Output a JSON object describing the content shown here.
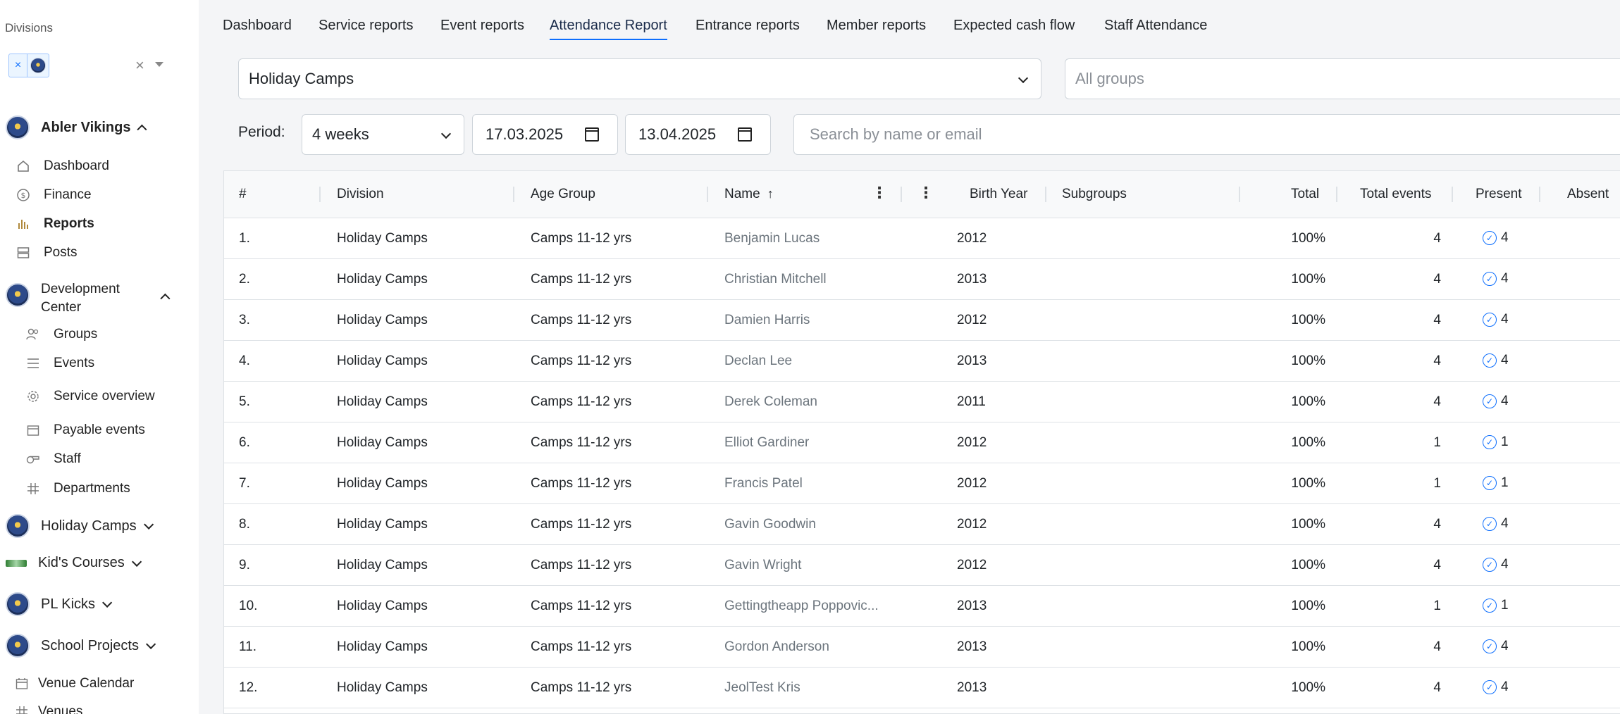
{
  "sidebar": {
    "divisions_label": "Divisions",
    "chip_remove": "×",
    "clear": "×",
    "orgs": {
      "abler": "Abler Vikings",
      "dev_center_line1": "Development",
      "dev_center_line2": "Center",
      "holiday": "Holiday Camps",
      "kids": "Kid's Courses",
      "pl": "PL Kicks",
      "school": "School Projects"
    },
    "items": {
      "dashboard": "Dashboard",
      "finance": "Finance",
      "reports": "Reports",
      "posts": "Posts",
      "groups": "Groups",
      "events": "Events",
      "service_overview": "Service overview",
      "payable_events": "Payable events",
      "staff": "Staff",
      "departments": "Departments",
      "venue_calendar": "Venue Calendar",
      "venues": "Venues"
    }
  },
  "tabs": {
    "dashboard": "Dashboard",
    "service_reports": "Service reports",
    "event_reports": "Event reports",
    "attendance_report": "Attendance Report",
    "entrance_reports": "Entrance reports",
    "member_reports": "Member reports",
    "expected_cash_flow": "Expected cash flow",
    "staff_attendance": "Staff Attendance"
  },
  "filters": {
    "division": "Holiday Camps",
    "groups_placeholder": "All groups",
    "period_label": "Period:",
    "period": "4 weeks",
    "date_from": "17.03.2025",
    "date_to": "13.04.2025",
    "search_placeholder": "Search by name or email"
  },
  "table": {
    "headers": {
      "num": "#",
      "division": "Division",
      "age_group": "Age Group",
      "name": "Name",
      "sort_arrow": "↑",
      "birth_year": "Birth Year",
      "subgroups": "Subgroups",
      "total": "Total",
      "total_events": "Total events",
      "present": "Present",
      "absent": "Absent"
    },
    "rows": [
      {
        "num": "1.",
        "division": "Holiday Camps",
        "age_group": "Camps 11-12 yrs",
        "name": "Benjamin Lucas",
        "birth_year": "2012",
        "total": "100%",
        "total_events": "4",
        "present": "4"
      },
      {
        "num": "2.",
        "division": "Holiday Camps",
        "age_group": "Camps 11-12 yrs",
        "name": "Christian Mitchell",
        "birth_year": "2013",
        "total": "100%",
        "total_events": "4",
        "present": "4"
      },
      {
        "num": "3.",
        "division": "Holiday Camps",
        "age_group": "Camps 11-12 yrs",
        "name": "Damien Harris",
        "birth_year": "2012",
        "total": "100%",
        "total_events": "4",
        "present": "4"
      },
      {
        "num": "4.",
        "division": "Holiday Camps",
        "age_group": "Camps 11-12 yrs",
        "name": "Declan Lee",
        "birth_year": "2013",
        "total": "100%",
        "total_events": "4",
        "present": "4"
      },
      {
        "num": "5.",
        "division": "Holiday Camps",
        "age_group": "Camps 11-12 yrs",
        "name": "Derek Coleman",
        "birth_year": "2011",
        "total": "100%",
        "total_events": "4",
        "present": "4"
      },
      {
        "num": "6.",
        "division": "Holiday Camps",
        "age_group": "Camps 11-12 yrs",
        "name": "Elliot Gardiner",
        "birth_year": "2012",
        "total": "100%",
        "total_events": "1",
        "present": "1"
      },
      {
        "num": "7.",
        "division": "Holiday Camps",
        "age_group": "Camps 11-12 yrs",
        "name": "Francis Patel",
        "birth_year": "2012",
        "total": "100%",
        "total_events": "1",
        "present": "1"
      },
      {
        "num": "8.",
        "division": "Holiday Camps",
        "age_group": "Camps 11-12 yrs",
        "name": "Gavin Goodwin",
        "birth_year": "2012",
        "total": "100%",
        "total_events": "4",
        "present": "4"
      },
      {
        "num": "9.",
        "division": "Holiday Camps",
        "age_group": "Camps 11-12 yrs",
        "name": "Gavin Wright",
        "birth_year": "2012",
        "total": "100%",
        "total_events": "4",
        "present": "4"
      },
      {
        "num": "10.",
        "division": "Holiday Camps",
        "age_group": "Camps 11-12 yrs",
        "name": "Gettingtheapp Poppovic...",
        "birth_year": "2013",
        "total": "100%",
        "total_events": "1",
        "present": "1"
      },
      {
        "num": "11.",
        "division": "Holiday Camps",
        "age_group": "Camps 11-12 yrs",
        "name": "Gordon Anderson",
        "birth_year": "2013",
        "total": "100%",
        "total_events": "4",
        "present": "4"
      },
      {
        "num": "12.",
        "division": "Holiday Camps",
        "age_group": "Camps 11-12 yrs",
        "name": "JeolTest Kris",
        "birth_year": "2013",
        "total": "100%",
        "total_events": "4",
        "present": "4"
      }
    ]
  },
  "colors": {
    "accent": "#0d6efd",
    "sidebar_bg": "#ffffff",
    "main_bg": "#f4f5f7"
  }
}
